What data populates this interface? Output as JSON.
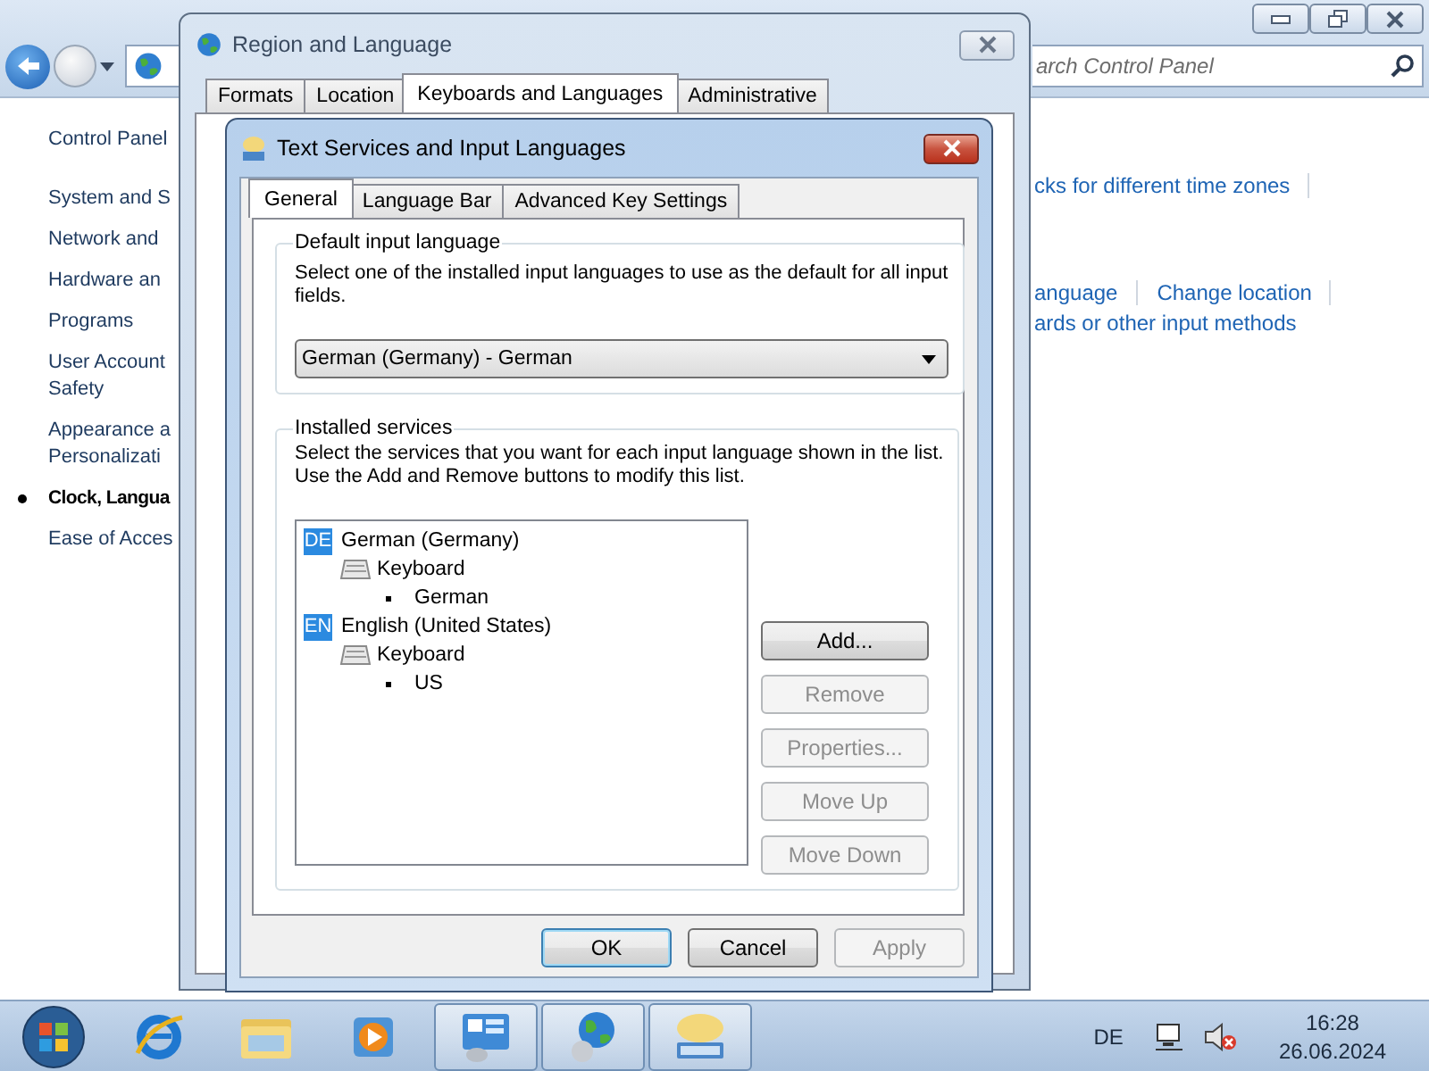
{
  "control_panel": {
    "search": {
      "placeholder": "arch Control Panel"
    },
    "sidebar": {
      "home": "Control Panel",
      "items": [
        {
          "lines": [
            "System and S"
          ],
          "selected": false
        },
        {
          "lines": [
            "Network and"
          ],
          "selected": false
        },
        {
          "lines": [
            "Hardware an"
          ],
          "selected": false
        },
        {
          "lines": [
            "Programs"
          ],
          "selected": false
        },
        {
          "lines": [
            "User Account",
            "Safety"
          ],
          "selected": false
        },
        {
          "lines": [
            "Appearance a",
            "Personalizati"
          ],
          "selected": false
        },
        {
          "lines": [
            "Clock, Langua"
          ],
          "selected": true
        },
        {
          "lines": [
            "Ease of Acces"
          ],
          "selected": false
        }
      ]
    },
    "task_groups": [
      {
        "lines": [
          [
            {
              "text": "cks for different time zones",
              "divider": true
            }
          ]
        ]
      },
      {
        "lines": [
          [
            {
              "text": "anguage",
              "divider": true
            },
            {
              "text": "Change location",
              "divider": true
            }
          ],
          [
            {
              "text": "ards or other input methods",
              "divider": false
            }
          ]
        ]
      }
    ]
  },
  "region_dialog": {
    "title": "Region and Language",
    "tabs": [
      {
        "label": "Formats",
        "selected": false
      },
      {
        "label": "Location",
        "selected": false
      },
      {
        "label": "Keyboards and Languages",
        "selected": true
      },
      {
        "label": "Administrative",
        "selected": false
      }
    ]
  },
  "text_services_dialog": {
    "title": "Text Services and Input Languages",
    "tabs": [
      {
        "label": "General",
        "selected": true
      },
      {
        "label": "Language Bar",
        "selected": false
      },
      {
        "label": "Advanced Key Settings",
        "selected": false
      }
    ],
    "default_language": {
      "heading": "Default input language",
      "description_lines": [
        "Select one of the installed input languages to use as the default for all input",
        "fields."
      ],
      "value": "German (Germany) - German"
    },
    "installed_services": {
      "heading": "Installed services",
      "description_lines": [
        "Select the services that you want for each input language shown in the list.",
        "Use the Add and Remove buttons to modify this list."
      ],
      "tree": [
        {
          "kind": "language",
          "badge": "DE",
          "label": "German (Germany)",
          "children": [
            {
              "kind": "category",
              "label": "Keyboard",
              "children": [
                {
                  "kind": "service",
                  "label": "German"
                }
              ]
            }
          ]
        },
        {
          "kind": "language",
          "badge": "EN",
          "label": "English (United States)",
          "children": [
            {
              "kind": "category",
              "label": "Keyboard",
              "children": [
                {
                  "kind": "service",
                  "label": "US"
                }
              ]
            }
          ]
        }
      ],
      "buttons": [
        {
          "label": "Add...",
          "disabled": false
        },
        {
          "label": "Remove",
          "disabled": true
        },
        {
          "label": "Properties...",
          "disabled": true
        },
        {
          "label": "Move Up",
          "disabled": true
        },
        {
          "label": "Move Down",
          "disabled": true
        }
      ]
    },
    "footer_buttons": [
      {
        "label": "OK",
        "default": true,
        "disabled": false
      },
      {
        "label": "Cancel",
        "default": false,
        "disabled": false
      },
      {
        "label": "Apply",
        "default": false,
        "disabled": true
      }
    ]
  },
  "taskbar": {
    "apps": [
      {
        "kind": "browser",
        "active": false
      },
      {
        "kind": "folder",
        "active": false
      },
      {
        "kind": "media",
        "active": false
      },
      {
        "kind": "control-panel",
        "active": true
      },
      {
        "kind": "globe",
        "active": true
      },
      {
        "kind": "keyboard",
        "active": true
      }
    ],
    "tray": {
      "language": "DE",
      "volume_muted": true,
      "time": "16:28",
      "date": "26.06.2024"
    }
  }
}
